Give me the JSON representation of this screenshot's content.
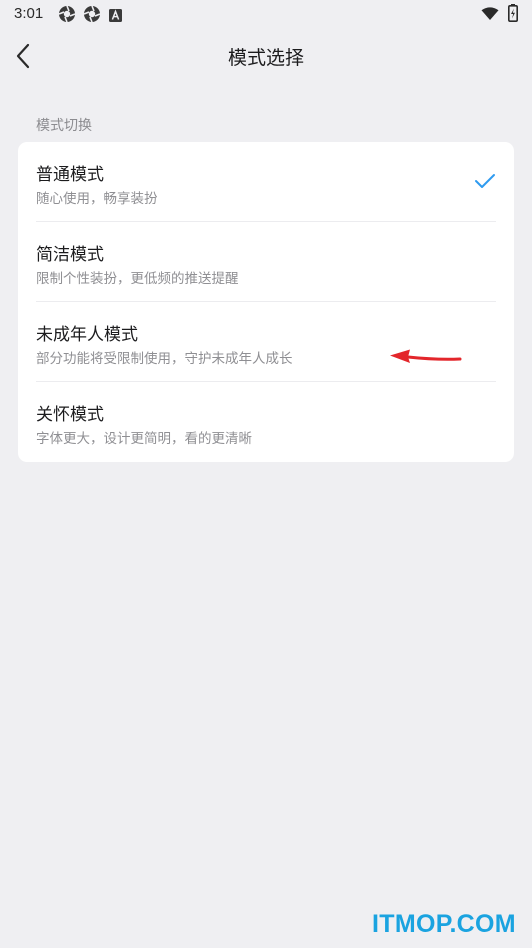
{
  "status_bar": {
    "time": "3:01",
    "icons": [
      "aperture-icon",
      "aperture-icon",
      "a-badge-icon",
      "wifi-icon",
      "battery-charging-icon"
    ]
  },
  "header": {
    "title": "模式选择",
    "back_icon": "chevron-left-icon"
  },
  "section": {
    "label": "模式切换"
  },
  "options": [
    {
      "title": "普通模式",
      "description": "随心使用，畅享装扮",
      "selected": true
    },
    {
      "title": "简洁模式",
      "description": "限制个性装扮，更低频的推送提醒",
      "selected": false
    },
    {
      "title": "未成年人模式",
      "description": "部分功能将受限制使用，守护未成年人成长",
      "selected": false
    },
    {
      "title": "关怀模式",
      "description": "字体更大，设计更简明，看的更清晰",
      "selected": false
    }
  ],
  "watermark": "ITMOP.COM",
  "colors": {
    "background": "#efeff2",
    "card": "#ffffff",
    "check": "#2f9bf0",
    "annotation_arrow": "#e3262b",
    "watermark": "#1aa3e0"
  }
}
